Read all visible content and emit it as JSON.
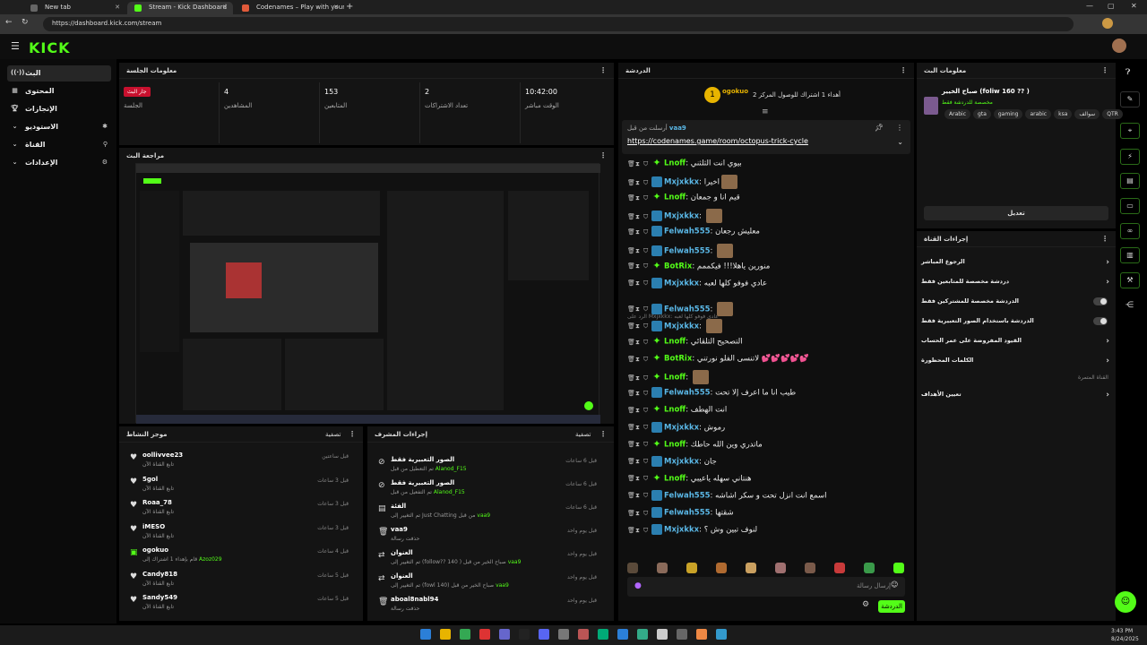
{
  "browser": {
    "tabs": [
      {
        "title": "New tab"
      },
      {
        "title": "Stream - Kick Dashboard"
      },
      {
        "title": "Codenames – Play with your Frie"
      }
    ],
    "url": "https://dashboard.kick.com/stream"
  },
  "app": {
    "logo": "KICK"
  },
  "leftnav": {
    "items": [
      {
        "label": "البث",
        "icon": "radio-icon"
      },
      {
        "label": "المحتوى",
        "icon": "grid-icon"
      },
      {
        "label": "الإنجازات",
        "icon": "trophy-icon"
      },
      {
        "label": "الاستوديو",
        "icon": "studio-icon"
      },
      {
        "label": "القناة",
        "icon": "channel-icon"
      },
      {
        "label": "الإعدادات",
        "icon": "gear-icon"
      }
    ]
  },
  "session": {
    "title": "معلومات الجلسة",
    "stats": [
      {
        "label": "الجلسة",
        "badge": "جار البث"
      },
      {
        "label": "المشاهدين",
        "value": "4"
      },
      {
        "label": "المتابعين",
        "value": "153"
      },
      {
        "label": "تعداد الاشتراكات",
        "value": "2"
      },
      {
        "label": "الوقت مباشر",
        "value": "10:42:00"
      }
    ]
  },
  "preview": {
    "title": "مراجعة البث"
  },
  "activity": {
    "title": "موجز النشاط",
    "filter": "تصفية",
    "items": [
      {
        "name": "oollivvee23",
        "sub": "تابع القناة الآن",
        "time": "قبل ساعتين"
      },
      {
        "name": "5gol",
        "sub": "تابع القناة الآن",
        "time": "قبل 3 ساعات"
      },
      {
        "name": "Roaa_78",
        "sub": "تابع القناة الآن",
        "time": "قبل 3 ساعات"
      },
      {
        "name": "iMESO",
        "sub": "تابع القناة الآن",
        "time": "قبل 3 ساعات"
      },
      {
        "name": "ogokuo",
        "sub": "قام بإهداء 1 اشتراك إلى",
        "sub2": "Azoz029",
        "time": "قبل 4 ساعات"
      },
      {
        "name": "Candy818",
        "sub": "تابع القناة الآن",
        "time": "قبل 5 ساعات"
      },
      {
        "name": "Sandy549",
        "sub": "تابع القناة الآن",
        "time": "قبل 5 ساعات"
      }
    ]
  },
  "modactions": {
    "title": "إجراءات المشرف",
    "filter": "تصفية",
    "items": [
      {
        "name": "الصور التعبيرية فقط",
        "sub": "تم التعطيل من قبل",
        "who": "Alanod_F15",
        "time": "قبل 6 ساعات"
      },
      {
        "name": "الصور التعبيرية فقط",
        "sub": "تم التفعيل من قبل",
        "who": "Alanod_F15",
        "time": "قبل 6 ساعات"
      },
      {
        "name": "الفئة",
        "sub": "تم التغيير إلى Just Chatting من قبل",
        "who": "vaa9",
        "time": "قبل 6 ساعات"
      },
      {
        "name": "vaa9",
        "sub": "حذفت رسالة",
        "who": "",
        "time": "قبل يوم واحد"
      },
      {
        "name": "العنوان",
        "sub": "تم التغيير إلى (follow?? 140 ) صباح الخير من قبل",
        "who": "vaa9",
        "time": "قبل يوم واحد"
      },
      {
        "name": "العنوان",
        "sub": "تم التغيير إلى (fowl 140) صباح الخير من قبل",
        "who": "vaa9",
        "time": "قبل يوم واحد"
      },
      {
        "name": "aboal8nabl94",
        "sub": "حذفت رسالة",
        "who": "",
        "time": "قبل يوم واحد"
      }
    ]
  },
  "chat": {
    "title": "الدردشة",
    "gift_user": "ogokuo",
    "gift_count": "1",
    "gift_text": "أهداء 1 اشتراك للوصول المركز 2",
    "pinned_by": "vaa9",
    "pinned_label": "أرسلت من قبل",
    "pinned_link": "https://codenames.game/room/octopus-trick-cycle",
    "deleted_note": "الرد على Mxjxkkx: عادي فوفو كلها لعبه",
    "messages": [
      {
        "user": "Lnoff",
        "text": "بيوي انت الثلثني",
        "color": "#53fc18",
        "emote": false
      },
      {
        "user": "Mxjxkkx",
        "text": "اخيرا",
        "color": "#5ab7e6",
        "emote": true
      },
      {
        "user": "Lnoff",
        "text": "قيم انا و جمعان",
        "color": "#53fc18",
        "emote": false
      },
      {
        "user": "Mxjxkkx",
        "text": "",
        "color": "#5ab7e6",
        "emote": true
      },
      {
        "user": "Felwah555",
        "text": "معليش رجعان",
        "color": "#5ab7e6",
        "emote": false
      },
      {
        "user": "Felwah555",
        "text": "",
        "color": "#5ab7e6",
        "emote": true
      },
      {
        "user": "BotRix",
        "text": "منورين ياهلا!!! فيكممم",
        "color": "#53fc18",
        "emote": false
      },
      {
        "user": "Mxjxkkx",
        "text": "عادي فوفو كلها لعبه",
        "color": "#5ab7e6",
        "emote": false
      },
      {
        "user": "Felwah555",
        "text": "",
        "color": "#5ab7e6",
        "emote": true
      },
      {
        "user": "Mxjxkkx",
        "text": "",
        "color": "#5ab7e6",
        "emote": true
      },
      {
        "user": "Lnoff",
        "text": "التصحيح التلقائي",
        "color": "#53fc18",
        "emote": false
      },
      {
        "user": "BotRix",
        "text": "لاتنسى الفلو نورتني 💕💕💕💕💕",
        "color": "#53fc18",
        "emote": false
      },
      {
        "user": "Lnoff",
        "text": "",
        "color": "#53fc18",
        "emote": true
      },
      {
        "user": "Felwah555",
        "text": "طيب انا ما اعرف إلا تحت",
        "color": "#5ab7e6",
        "emote": false
      },
      {
        "user": "Lnoff",
        "text": "انت الهطف",
        "color": "#53fc18",
        "emote": false
      },
      {
        "user": "Mxjxkkx",
        "text": "رموش",
        "color": "#5ab7e6",
        "emote": false
      },
      {
        "user": "Lnoff",
        "text": "ماتدري وين الله حاطك",
        "color": "#53fc18",
        "emote": false
      },
      {
        "user": "Mxjxkkx",
        "text": "جان",
        "color": "#5ab7e6",
        "emote": false
      },
      {
        "user": "Lnoff",
        "text": "هنتاني سهله ياعيبي",
        "color": "#53fc18",
        "emote": false
      },
      {
        "user": "Felwah555",
        "text": "اسمع انت انزل تحت و سكر اشاشه",
        "color": "#5ab7e6",
        "emote": false
      },
      {
        "user": "Felwah555",
        "text": "شقتها",
        "color": "#5ab7e6",
        "emote": false
      },
      {
        "user": "Mxjxkkx",
        "text": "لنوف تبين وش ؟",
        "color": "#5ab7e6",
        "emote": false
      }
    ],
    "input_placeholder": "إرسال رسالة",
    "send_label": "الدردشة"
  },
  "streaminfo": {
    "title": "معلومات البث",
    "stream_title": "صباح الخيير (foliw 160 ?? )",
    "category": "مخصصة للدردشة فقط",
    "tags": [
      "QTR",
      "سوالف",
      "ksa",
      "arabic",
      "gaming",
      "gta",
      "Arabic"
    ],
    "edit_label": "تعديل"
  },
  "channelactions": {
    "title": "إجراءات القناة",
    "rows": [
      {
        "label": "الرجوع المباشر",
        "kind": "chevron"
      },
      {
        "label": "دردشة مخصصة للمتابعين فقط",
        "kind": "chevron"
      },
      {
        "label": "الدردشة مخصصة للمشتركين فقط",
        "kind": "toggle"
      },
      {
        "label": "الدردشة باستخدام الصور التعبيرية فقط",
        "kind": "toggle"
      },
      {
        "label": "القيود المفروضة على عمر الحساب",
        "kind": "chevron"
      },
      {
        "label": "الكلمات المحظورة",
        "kind": "chevron"
      }
    ],
    "section2": "القناة المتمرة",
    "goals": "تعيين الأهداف"
  },
  "taskbar": {
    "time": "3:43 PM",
    "date": "8/24/2025"
  },
  "colors": {
    "accent": "#53fc18",
    "live": "#c8102e",
    "bg": "#000000",
    "panel": "#141414"
  }
}
